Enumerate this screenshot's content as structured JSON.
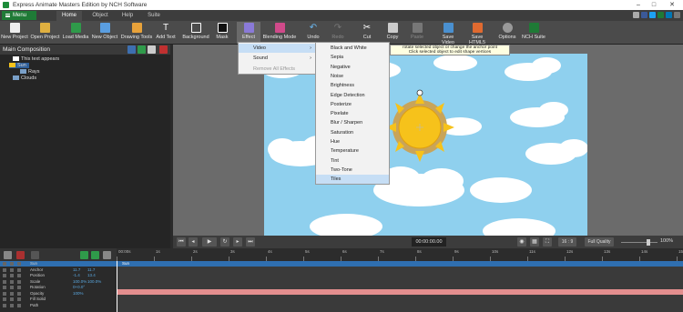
{
  "window": {
    "title": "Express Animate Masters Edition by NCH Software"
  },
  "ribbon": {
    "menu_label": "Menu",
    "tabs": [
      {
        "label": "Home"
      },
      {
        "label": "Object"
      },
      {
        "label": "Help"
      },
      {
        "label": "Suite"
      }
    ]
  },
  "toolbar": {
    "buttons": [
      {
        "label": "New Project"
      },
      {
        "label": "Open Project"
      },
      {
        "label": "Load Media"
      },
      {
        "label": "New Object"
      },
      {
        "label": "Drawing Tools"
      },
      {
        "label": "Add Text"
      },
      {
        "label": "Background"
      },
      {
        "label": "Mask"
      },
      {
        "label": "Effect"
      },
      {
        "label": "Blending Mode"
      },
      {
        "label": "Undo"
      },
      {
        "label": "Redo"
      },
      {
        "label": "Cut"
      },
      {
        "label": "Copy"
      },
      {
        "label": "Paste"
      },
      {
        "label": "Save Video"
      },
      {
        "label": "Save HTML5"
      },
      {
        "label": "Options"
      },
      {
        "label": "NCH Suite"
      }
    ]
  },
  "composition": {
    "title": "Main Composition",
    "tree": [
      {
        "label": "This text appears"
      },
      {
        "label": "Sun"
      },
      {
        "label": "Rays"
      },
      {
        "label": "Clouds"
      }
    ]
  },
  "effect_menu": {
    "items": [
      {
        "label": "Video"
      },
      {
        "label": "Sound"
      },
      {
        "label": "Remove All Effects"
      }
    ],
    "video_submenu": [
      {
        "label": "Black and White"
      },
      {
        "label": "Sepia"
      },
      {
        "label": "Negative"
      },
      {
        "label": "Noise"
      },
      {
        "label": "Brightness"
      },
      {
        "label": "Edge Detection"
      },
      {
        "label": "Posterize"
      },
      {
        "label": "Pixelate"
      },
      {
        "label": "Blur / Sharpen"
      },
      {
        "label": "Saturation"
      },
      {
        "label": "Hue"
      },
      {
        "label": "Temperature"
      },
      {
        "label": "Tint"
      },
      {
        "label": "Two-Tone"
      },
      {
        "label": "Tiles"
      }
    ]
  },
  "tooltip": {
    "line1": "rotate selected object or change the anchor point",
    "line2": "Click selected object to edit shape vertices"
  },
  "playback": {
    "timecode": "00:00:00.00",
    "aspect": "16 : 9",
    "quality": "Full Quality",
    "zoom": "100%"
  },
  "timeline": {
    "ticks": [
      "00:00s",
      "1s",
      "2s",
      "3s",
      "4s",
      "5s",
      "6s",
      "7s",
      "8s",
      "9s",
      "10s",
      "11s",
      "12s",
      "13s",
      "14s",
      "15s"
    ],
    "track_label": "Sun",
    "properties": [
      {
        "name": "Sun",
        "v1": "",
        "v2": ""
      },
      {
        "name": "Anchor",
        "v1": "11.7",
        "v2": "11.7"
      },
      {
        "name": "Position",
        "v1": "-1.4",
        "v2": "13.4"
      },
      {
        "name": "Scale",
        "v1": "100.0%",
        "v2": "100.0%"
      },
      {
        "name": "Rotation",
        "v1": "0+0.0°",
        "v2": ""
      },
      {
        "name": "Opacity",
        "v1": "100%",
        "v2": ""
      },
      {
        "name": "Fill Solid",
        "v1": "",
        "v2": ""
      },
      {
        "name": "Path",
        "v1": "",
        "v2": ""
      }
    ]
  },
  "colors": {
    "accent": "#1f7a36",
    "selection": "#c6def5",
    "sky": "#8fd0ee",
    "sun": "#f6c21b",
    "track": "#e38e8e"
  }
}
